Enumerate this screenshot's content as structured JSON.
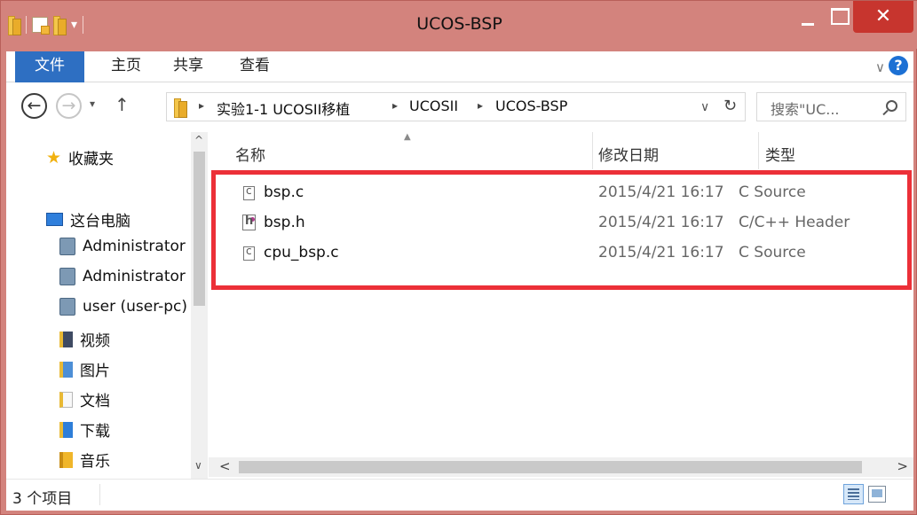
{
  "window": {
    "title": "UCOS-BSP",
    "close_glyph": "✕"
  },
  "ribbon": {
    "tabs": [
      "文件",
      "主页",
      "共享",
      "查看"
    ],
    "expand_glyph": "∨",
    "help_glyph": "?"
  },
  "nav": {
    "back_glyph": "←",
    "forward_glyph": "→",
    "recent_glyph": "▾",
    "up_glyph": "↑"
  },
  "address": {
    "breadcrumbs": [
      "实验1-1 UCOSII移植",
      "UCOSII",
      "UCOS-BSP"
    ],
    "separator_glyph": "▸",
    "dropdown_glyph": "∨",
    "refresh_glyph": "↻"
  },
  "search": {
    "placeholder": "搜索\"UC..."
  },
  "navpane": {
    "favorites": "收藏夹",
    "this_pc": "这台电脑",
    "items": [
      {
        "label": "Administrator",
        "icon": "user-folder-icon"
      },
      {
        "label": "Administrator",
        "icon": "user-folder-icon"
      },
      {
        "label": "user (user-pc)",
        "icon": "user-folder-icon"
      },
      {
        "label": "视频",
        "icon": "videos-icon"
      },
      {
        "label": "图片",
        "icon": "pictures-icon"
      },
      {
        "label": "文档",
        "icon": "documents-icon"
      },
      {
        "label": "下载",
        "icon": "downloads-icon"
      },
      {
        "label": "音乐",
        "icon": "music-icon"
      }
    ]
  },
  "columns": {
    "name": "名称",
    "date": "修改日期",
    "type": "类型"
  },
  "files": [
    {
      "name": "bsp.c",
      "date": "2015/4/21 16:17",
      "type": "C Source",
      "icon": "c-source-file-icon"
    },
    {
      "name": "bsp.h",
      "date": "2015/4/21 16:17",
      "type": "C/C++ Header",
      "icon": "c-header-file-icon"
    },
    {
      "name": "cpu_bsp.c",
      "date": "2015/4/21 16:17",
      "type": "C Source",
      "icon": "c-source-file-icon"
    }
  ],
  "status": {
    "count": "3 个项目"
  },
  "scroll_glyphs": {
    "up": "^",
    "down": "∨",
    "left": "<",
    "right": ">"
  },
  "colors": {
    "titlebar": "#d3837d",
    "file_tab": "#2e6fc2",
    "close_button": "#c7352e",
    "highlight_box": "#ec3038"
  }
}
